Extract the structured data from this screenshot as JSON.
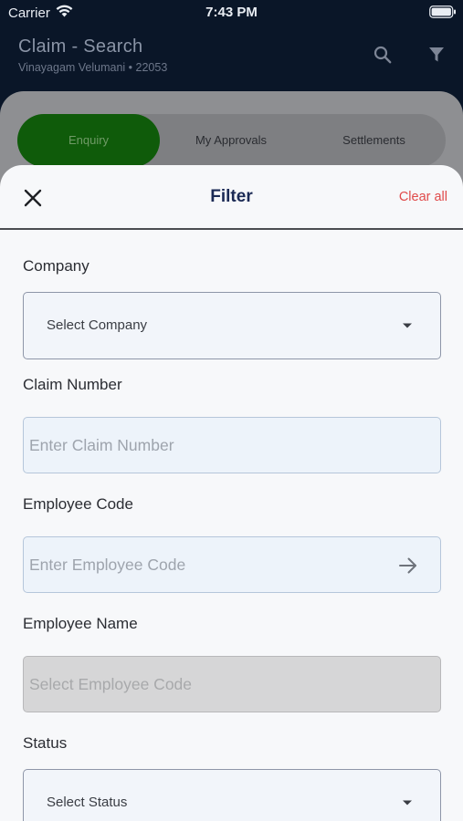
{
  "status_bar": {
    "carrier": "Carrier",
    "time": "7:43 PM",
    "icons": [
      "wifi-icon",
      "battery-icon"
    ]
  },
  "header": {
    "title": "Claim - Search",
    "subtitle": "Vinayagam Velumani • 22053",
    "icons": [
      "search-icon",
      "filter-icon"
    ]
  },
  "tabs": [
    {
      "label": "Enquiry",
      "active": true
    },
    {
      "label": "My Approvals",
      "active": false
    },
    {
      "label": "Settlements",
      "active": false
    }
  ],
  "filter": {
    "title": "Filter",
    "clear_label": "Clear all",
    "close_icon": "close-icon",
    "company": {
      "label": "Company",
      "value": "Select Company"
    },
    "claim_number": {
      "label": "Claim Number",
      "placeholder": "Enter Claim Number"
    },
    "employee_code": {
      "label": "Employee Code",
      "placeholder": "Enter Employee Code"
    },
    "employee_name": {
      "label": "Employee Name",
      "placeholder": "Select Employee Code"
    },
    "status": {
      "label": "Status",
      "value": "Select Status"
    }
  },
  "colors": {
    "header_bg": "#0a1628",
    "active_tab": "#0f5b0a",
    "sheet_bg": "#f7f8fa",
    "title": "#1b2a55",
    "clear_all": "#e04a4a",
    "input_bg": "#edf3fa",
    "disabled_input_bg": "#d6d6d7"
  }
}
